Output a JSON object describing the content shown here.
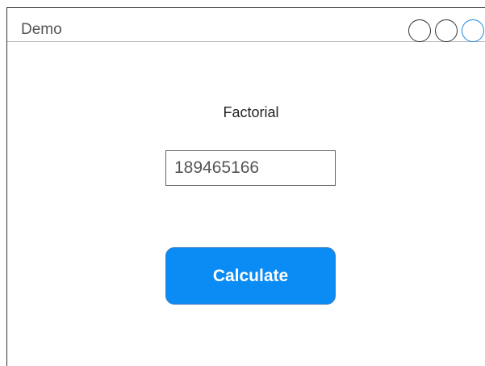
{
  "window": {
    "title": "Demo"
  },
  "titlebar": {
    "controls": [
      "circle-icon",
      "circle-icon",
      "circle-icon"
    ],
    "control_colors": [
      "#333333",
      "#333333",
      "#1e88e5"
    ]
  },
  "main": {
    "heading": "Factorial",
    "input_value": "189465166",
    "button_label": "Calculate"
  },
  "colors": {
    "accent": "#0b8cf5"
  }
}
